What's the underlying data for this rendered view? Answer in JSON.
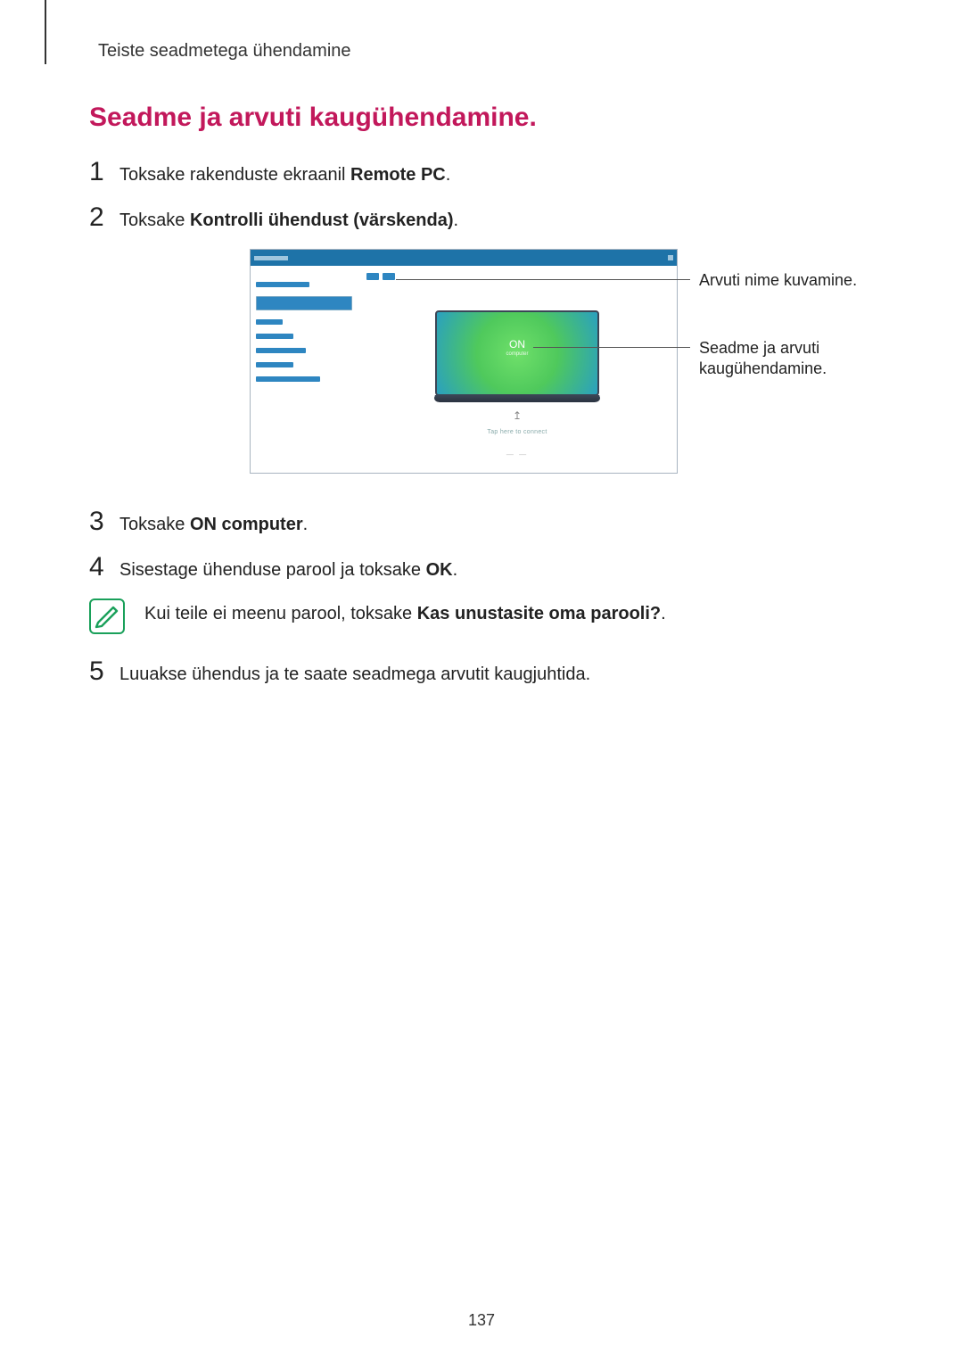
{
  "header": {
    "running_head": "Teiste seadmetega ühendamine"
  },
  "section_title": "Seadme ja arvuti kaugühendamine.",
  "steps": {
    "s1": {
      "num": "1",
      "pre": "Toksake rakenduste ekraanil ",
      "bold": "Remote PC",
      "post": "."
    },
    "s2": {
      "num": "2",
      "pre": "Toksake ",
      "bold": "Kontrolli ühendust (värskenda)",
      "post": "."
    },
    "s3": {
      "num": "3",
      "pre": "Toksake ",
      "bold": "ON computer",
      "post": "."
    },
    "s4": {
      "num": "4",
      "pre": "Sisestage ühenduse parool ja toksake ",
      "bold": "OK",
      "post": "."
    },
    "s5": {
      "num": "5",
      "text": "Luuakse ühendus ja te saate seadmega arvutit kaugjuhtida."
    }
  },
  "note": {
    "pre": "Kui teile ei meenu parool, toksake ",
    "bold": "Kas unustasite oma parooli?",
    "post": "."
  },
  "illustration": {
    "on_label": "ON",
    "on_sub": "computer",
    "callout1": "Arvuti nime kuvamine.",
    "callout2": "Seadme ja arvuti kaugühendamine."
  },
  "page_number": "137"
}
